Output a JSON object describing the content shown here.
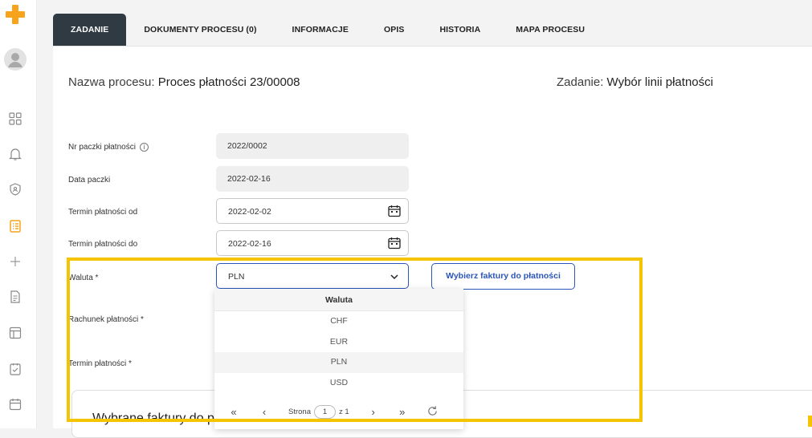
{
  "sidebar": {
    "icons": [
      "logo-plus-icon",
      "avatar-icon",
      "dashboard-grid-icon",
      "bell-icon",
      "shield-icon",
      "task-list-icon",
      "plus-icon",
      "document-icon",
      "layout-icon",
      "checklist-icon",
      "calendar-icon"
    ],
    "accent_color": "#f7a31c"
  },
  "tabs": [
    {
      "label": "ZADANIE"
    },
    {
      "label": "DOKUMENTY PROCESU (0)"
    },
    {
      "label": "INFORMACJE"
    },
    {
      "label": "OPIS"
    },
    {
      "label": "HISTORIA"
    },
    {
      "label": "MAPA PROCESU"
    }
  ],
  "header": {
    "process_label": "Nazwa procesu:",
    "process_value": "Proces płatności 23/00008",
    "task_label": "Zadanie:",
    "task_value": "Wybór linii płatności"
  },
  "form": {
    "batch_no_label": "Nr paczki płatności",
    "batch_no_value": "2022/0002",
    "batch_date_label": "Data paczki",
    "batch_date_value": "2022-02-16",
    "due_from_label": "Termin płatności od",
    "due_from_value": "2022-02-02",
    "due_to_label": "Termin płatności do",
    "due_to_value": "2022-02-16",
    "currency_label": "Waluta *",
    "currency_value": "PLN",
    "account_label": "Rachunek płatności *",
    "due_date_label": "Termin płatności *",
    "select_invoices_button": "Wybierz faktury do płatności"
  },
  "dropdown": {
    "header": "Waluta",
    "options": [
      "CHF",
      "EUR",
      "PLN",
      "USD"
    ],
    "selected": "PLN",
    "pager": {
      "page_label": "Strona",
      "page": "1",
      "of_label": "z 1"
    }
  },
  "card": {
    "title": "Wybrane faktury do pła"
  },
  "colors": {
    "active_tab": "#2f3a43",
    "primary": "#2b55b8",
    "highlight": "#f4c400"
  }
}
